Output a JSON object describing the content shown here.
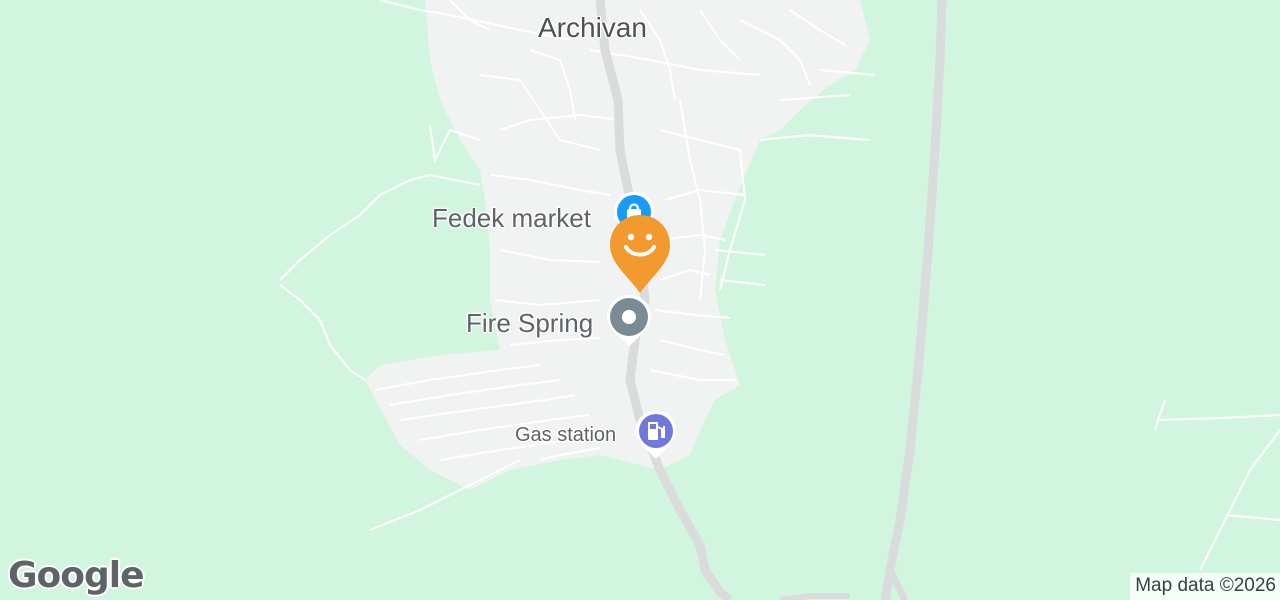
{
  "map": {
    "town": "Archivan",
    "pois": [
      {
        "name": "Fedek market",
        "icon": "shopping-bag-icon",
        "color": "#1a9bf5"
      },
      {
        "name": "Fire Spring",
        "icon": "landmark-icon",
        "color": "#7b8b95"
      },
      {
        "name": "Gas station",
        "icon": "gas-pump-icon",
        "color": "#7079d9"
      }
    ],
    "marker": {
      "icon": "smiley-icon",
      "color": "#f29a2e"
    }
  },
  "footer": {
    "attribution": "Map data ©2026",
    "logo": "Google"
  },
  "colors": {
    "land": "#d2f5e0",
    "urban": "#f1f2f2",
    "road": "#dadcdd",
    "street": "#ffffff"
  }
}
